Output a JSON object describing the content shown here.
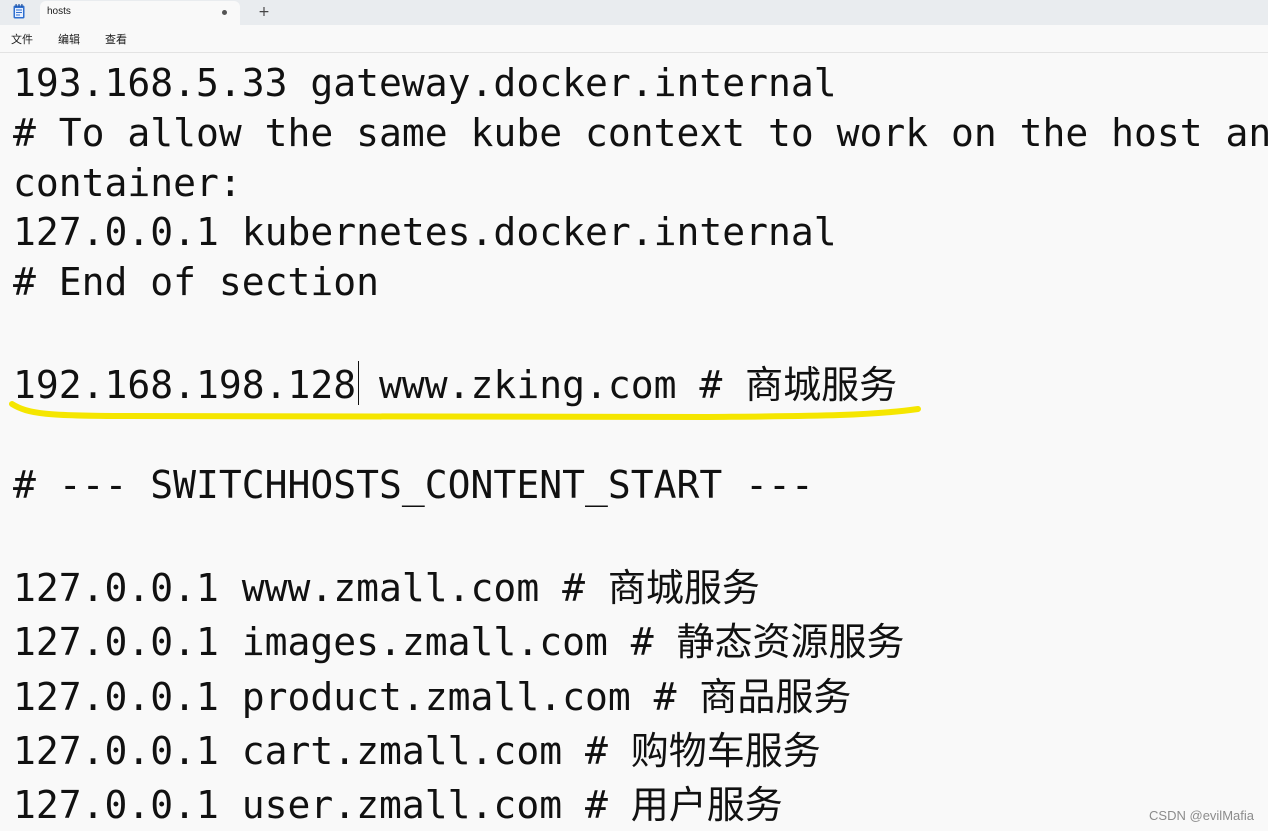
{
  "tab": {
    "title": "hosts",
    "new_tab_label": "+"
  },
  "menu": {
    "items": [
      "文件",
      "编辑",
      "查看"
    ]
  },
  "editor": {
    "lines": [
      "193.168.5.33 gateway.docker.internal",
      "# To allow the same kube context to work on the host and the",
      "container:",
      "127.0.0.1 kubernetes.docker.internal",
      "# End of section",
      "",
      "192.168.198.128 www.zking.com # 商城服务",
      "",
      "# --- SWITCHHOSTS_CONTENT_START ---",
      "",
      "127.0.0.1 www.zmall.com # 商城服务",
      "127.0.0.1 images.zmall.com # 静态资源服务",
      "127.0.0.1 product.zmall.com # 商品服务",
      "127.0.0.1 cart.zmall.com # 购物车服务",
      "127.0.0.1 user.zmall.com # 用户服务"
    ]
  },
  "annotation": {
    "highlight_color": "#f5e600"
  },
  "watermark": "CSDN @evilMafia",
  "icons": {
    "app": "notepad-icon",
    "tab_modified": "unsaved-dot-icon"
  }
}
